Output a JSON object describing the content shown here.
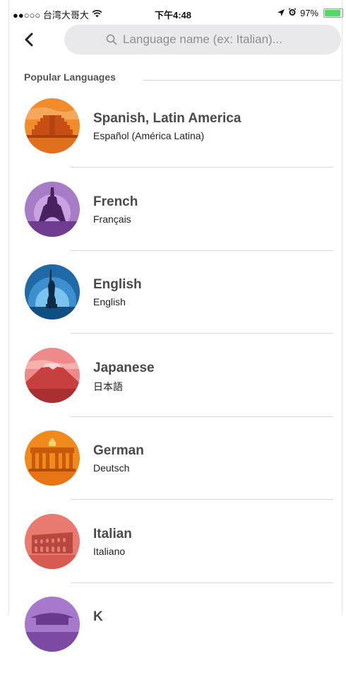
{
  "status_bar": {
    "carrier": "●●○○○ 台湾大哥大",
    "time": "下午4:48",
    "battery": "97%"
  },
  "search": {
    "placeholder": "Language name (ex: Italian)..."
  },
  "section": {
    "title": "Popular Languages"
  },
  "languages": [
    {
      "name": "Spanish, Latin America",
      "native": "Español (América Latina)",
      "icon": "pyramid-icon"
    },
    {
      "name": "French",
      "native": "Français",
      "icon": "eiffel-tower-icon"
    },
    {
      "name": "English",
      "native": "English",
      "icon": "statue-of-liberty-icon"
    },
    {
      "name": "Japanese",
      "native": "日本語",
      "icon": "mount-fuji-icon"
    },
    {
      "name": "German",
      "native": "Deutsch",
      "icon": "brandenburg-gate-icon"
    },
    {
      "name": "Italian",
      "native": "Italiano",
      "icon": "colosseum-icon"
    },
    {
      "name": "K",
      "native": "",
      "icon": "palace-icon"
    }
  ],
  "colors": {
    "accent_battery": "#4cd964",
    "search_bg": "#e9e9eb"
  }
}
